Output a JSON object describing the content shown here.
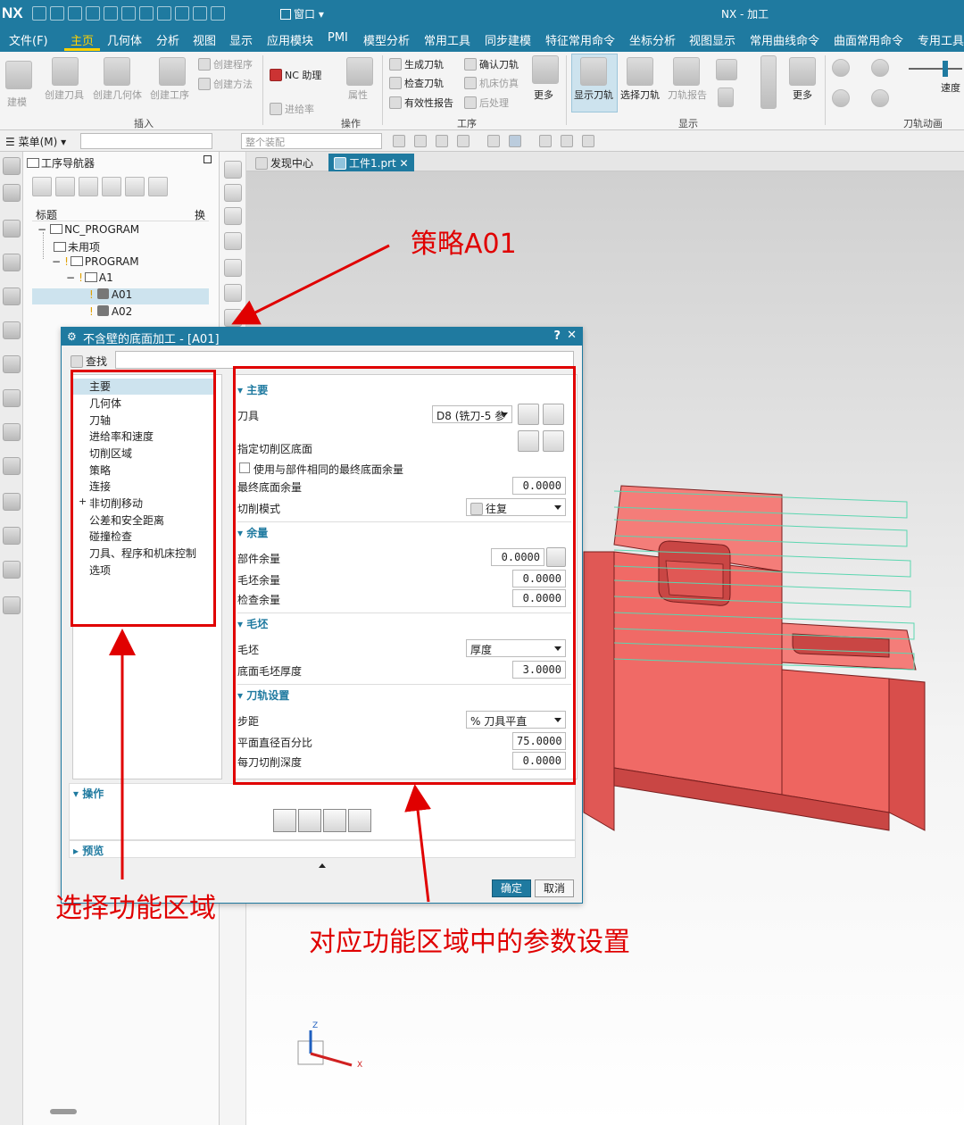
{
  "app": {
    "logo": "NX",
    "window_menu": "窗口",
    "title": "NX - 加工"
  },
  "menu_tabs": [
    {
      "label": "文件(F)",
      "active": false
    },
    {
      "label": "主页",
      "active": true
    },
    {
      "label": "几何体",
      "active": false
    },
    {
      "label": "分析",
      "active": false
    },
    {
      "label": "视图",
      "active": false
    },
    {
      "label": "显示",
      "active": false
    },
    {
      "label": "应用模块",
      "active": false
    },
    {
      "label": "PMI",
      "active": false
    },
    {
      "label": "模型分析",
      "active": false
    },
    {
      "label": "常用工具",
      "active": false
    },
    {
      "label": "同步建模",
      "active": false
    },
    {
      "label": "特征常用命令",
      "active": false
    },
    {
      "label": "坐标分析",
      "active": false
    },
    {
      "label": "视图显示",
      "active": false
    },
    {
      "label": "常用曲线命令",
      "active": false
    },
    {
      "label": "曲面常用命令",
      "active": false
    },
    {
      "label": "专用工具",
      "active": false
    }
  ],
  "ribbon": {
    "insert_items": [
      "建模",
      "创建刀具",
      "创建几何体",
      "创建工序"
    ],
    "create_program": "创建程序",
    "create_method": "创建方法",
    "nc_helper": "NC 助理",
    "feed_rate": "进给率",
    "attribute": "属性",
    "insert_group": "插入",
    "operation_group": "操作",
    "gen_path": "生成刀轨",
    "check_path": "检查刀轨",
    "validity_report": "有效性报告",
    "confirm_path": "确认刀轨",
    "machine_sim": "机床仿真",
    "post_process": "后处理",
    "more1": "更多",
    "process_group": "工序",
    "show_path": "显示刀轨",
    "select_path": "选择刀轨",
    "path_report": "刀轨报告",
    "more2": "更多",
    "display_group": "显示",
    "speed": "速度",
    "animation_group": "刀轨动画"
  },
  "selection_bar": {
    "menu": "菜单(M)",
    "filter_placeholder": "",
    "assembly": "整个装配"
  },
  "navigator": {
    "title": "工序导航器",
    "col_title": "标题",
    "col_change": "换",
    "tree": [
      "NC_PROGRAM",
      "未用项",
      "PROGRAM",
      "A1",
      "A01",
      "A02"
    ]
  },
  "doc_tabs": [
    {
      "label": "发现中心",
      "active": false
    },
    {
      "label": "工件1.prt",
      "active": true
    }
  ],
  "dialog": {
    "title": "不含壁的底面加工 - [A01]",
    "help": "?",
    "close": "✕",
    "find_label": "查找",
    "nav_items": [
      "主要",
      "几何体",
      "刀轴",
      "进给率和速度",
      "切削区域",
      "策略",
      "连接",
      "非切削移动",
      "公差和安全距离",
      "碰撞检查",
      "刀具、程序和机床控制",
      "选项"
    ],
    "sections": {
      "main": {
        "title": "主要",
        "tool_label": "刀具",
        "tool_value": "D8 (铣刀-5 参",
        "cut_floor_label": "指定切削区底面",
        "same_stock_label": "使用与部件相同的最终底面余量",
        "final_floor_stock_label": "最终底面余量",
        "final_floor_stock_value": "0.0000",
        "cut_pattern_label": "切削模式",
        "cut_pattern_value": "往复"
      },
      "stock": {
        "title": "余量",
        "part_stock_label": "部件余量",
        "part_stock_value": "0.0000",
        "blank_stock_label": "毛坯余量",
        "blank_stock_value": "0.0000",
        "check_stock_label": "检查余量",
        "check_stock_value": "0.0000"
      },
      "blank": {
        "title": "毛坯",
        "blank_label": "毛坯",
        "blank_value": "厚度",
        "floor_thickness_label": "底面毛坯厚度",
        "floor_thickness_value": "3.0000"
      },
      "path": {
        "title": "刀轨设置",
        "stepover_label": "步距",
        "stepover_value": "% 刀具平直",
        "flat_pct_label": "平面直径百分比",
        "flat_pct_value": "75.0000",
        "depth_label": "每刀切削深度",
        "depth_value": "0.0000"
      }
    },
    "operations_title": "操作",
    "preview_title": "预览",
    "ok": "确定",
    "cancel": "取消"
  },
  "annotations": {
    "strategy": "策略A01",
    "select_area": "选择功能区域",
    "param_setting": "对应功能区域中的参数设置",
    "color": "#e00000"
  },
  "model_color": "#f06a66",
  "axis": {
    "z": "Z",
    "x": "X"
  }
}
